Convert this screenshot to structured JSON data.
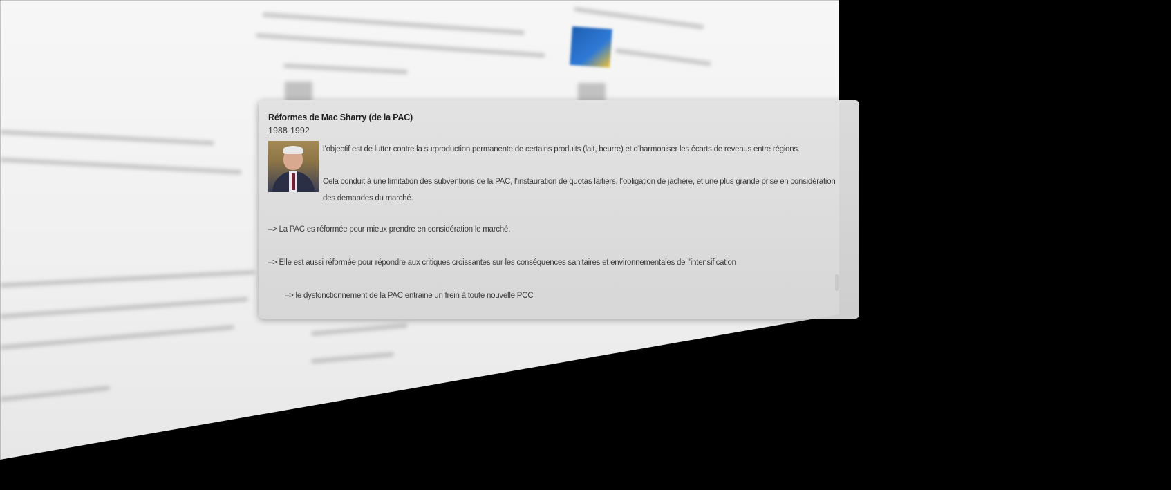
{
  "popover": {
    "title": "Réformes de Mac Sharry (de la PAC)",
    "years": "1988-1992",
    "portrait_icon": "portrait-photo",
    "paragraphs": [
      "l’objectif est de lutter contre la surproduction permanente de certains produits (lait, beurre) et d’harmoniser les écarts de revenus entre régions.",
      "Cela conduit à une limitation des subventions de la PAC, l’instauration de quotas laitiers, l’obligation de jachère, et une plus grande prise en considération des demandes du marché."
    ],
    "arrow_lines": [
      "–> La PAC es réformée pour mieux prendre en considération le marché.",
      "–> Elle est aussi réformée pour répondre aux critiques croissantes sur les conséquences sanitaires et environnementales de l’intensification",
      "–> le dysfonctionnement de la PAC entraine un frein à toute nouvelle PCC"
    ]
  },
  "colors": {
    "backdrop": "#000000",
    "page": "#f2f2f2",
    "card": "#dcdcdc",
    "title_text": "#1e1e1e",
    "body_text": "#3b3b3b"
  }
}
